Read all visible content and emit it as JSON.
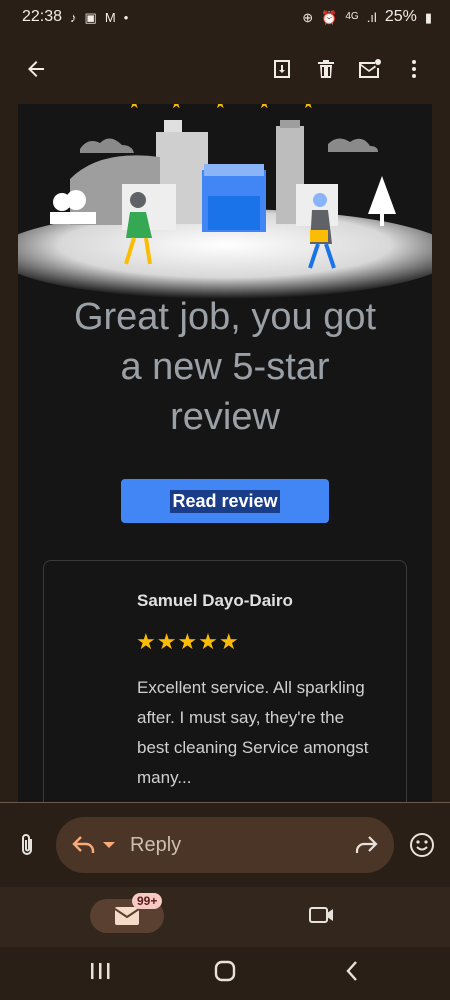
{
  "status_bar": {
    "time": "22:38",
    "battery": "25%",
    "network": "4G"
  },
  "toolbar": {
    "back": "back",
    "archive": "archive",
    "delete": "delete",
    "mark_unread": "mark-unread",
    "more": "more"
  },
  "email": {
    "headline_lines": [
      "Great job, you got",
      "a new 5-star",
      "review"
    ],
    "cta_label": "Read review",
    "review": {
      "reviewer": "Samuel Dayo-Dairo",
      "stars": "★★★★★",
      "text_lines": [
        "Excellent service. All sparkling",
        "after. I must say, they're the",
        "best cleaning Service amongst",
        "many..."
      ]
    }
  },
  "reply_bar": {
    "reply_label": "Reply"
  },
  "bottom_nav": {
    "mail_badge": "99+"
  },
  "colors": {
    "accent": "#4285f4",
    "star": "#fbbc04",
    "background": "#2a1f17"
  }
}
